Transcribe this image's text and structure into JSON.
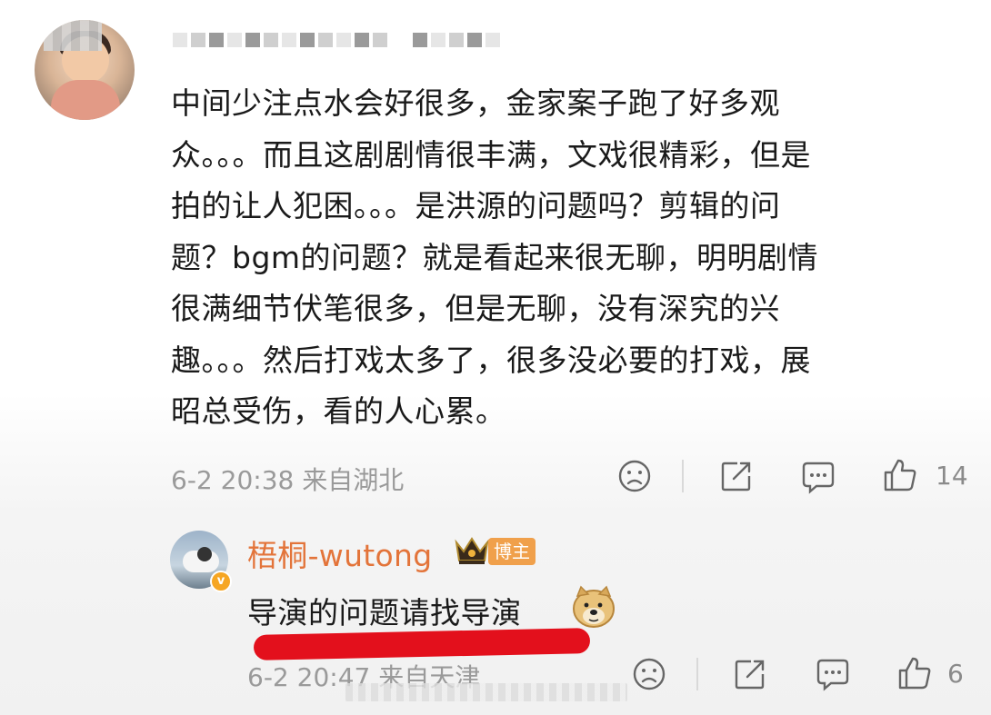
{
  "comment": {
    "lines": [
      "中间少注点水会好很多，金家案子跑了好多观",
      "众。。。而且这剧剧情很丰满，文戏很精彩，但是",
      "拍的让人犯困。。。是洪源的问题吗？剪辑的问",
      "题？bgm的问题？就是看起来很无聊，明明剧情",
      "很满细节伏笔很多，但是无聊，没有深究的兴",
      "趣。。。然后打戏太多了，很多没必要的打戏，展",
      "昭总受伤，看的人心累。"
    ],
    "meta": "6-2 20:38 来自湖北",
    "like_count": "14"
  },
  "reply": {
    "username": "梧桐-wutong",
    "badge": "博主",
    "text": "导演的问题请找导演",
    "meta": "6-2 20:47 来自天津",
    "like_count": "6"
  },
  "colors": {
    "reply_name": "#e3743a",
    "badge_bg": "#f0a04b",
    "red_mark": "#e3101c",
    "meta_text": "#9a9a9a"
  }
}
